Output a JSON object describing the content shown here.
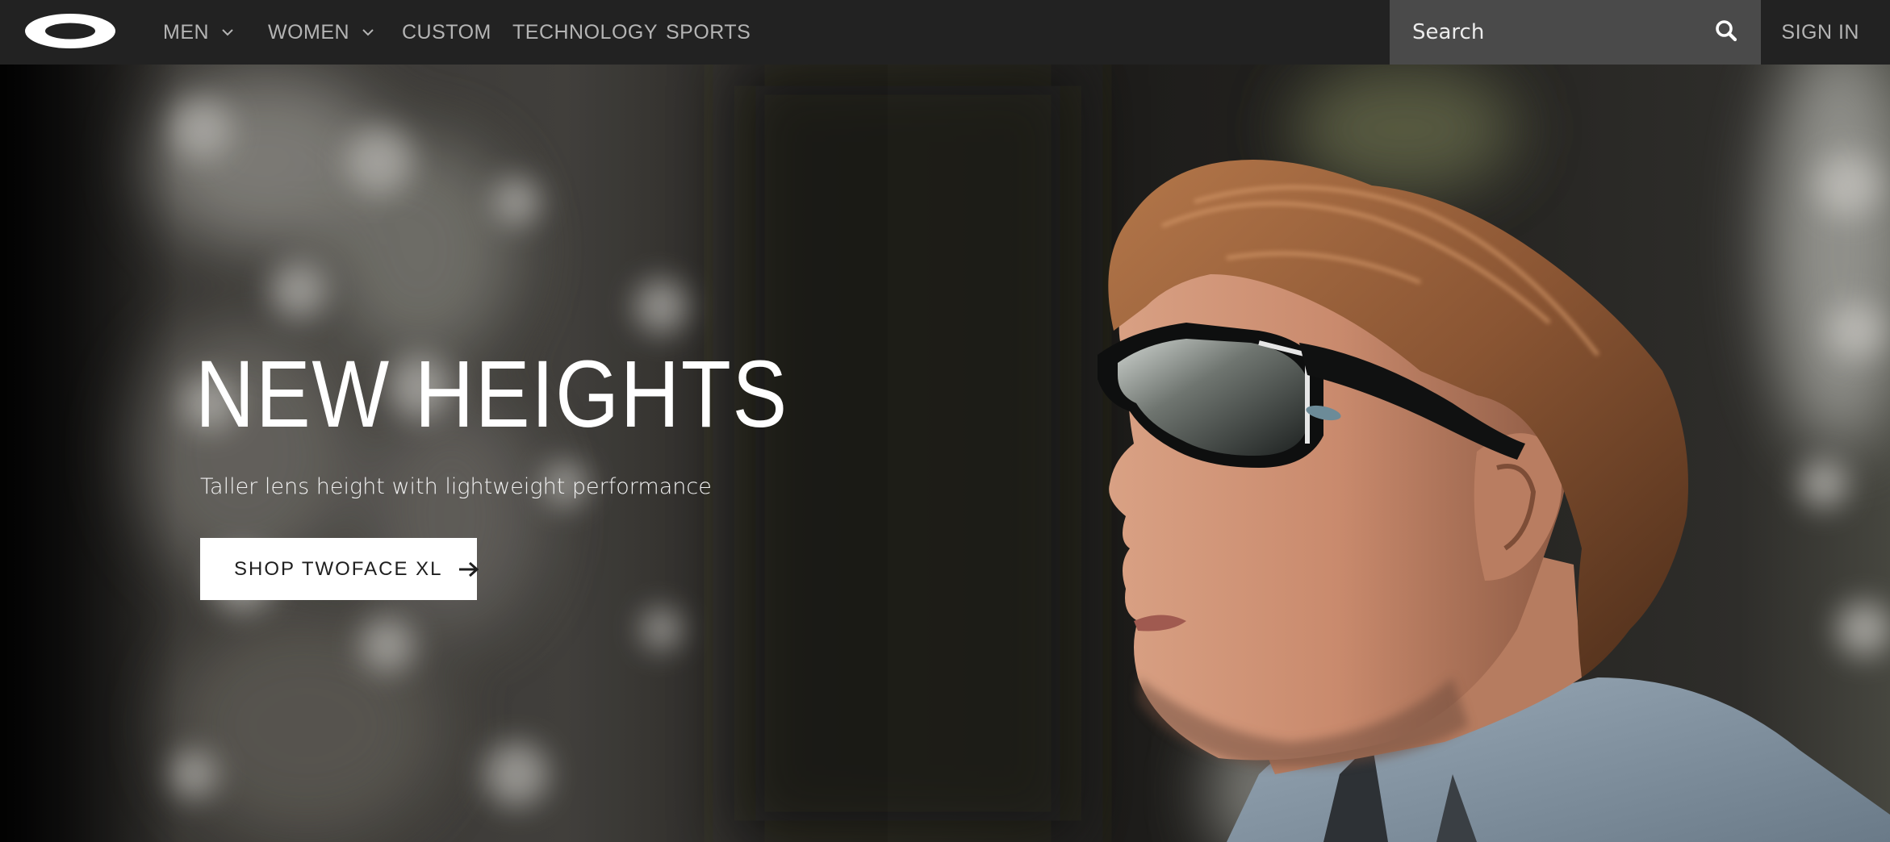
{
  "nav": {
    "logo_icon": "oakley-ellipse-logo-icon",
    "items": [
      {
        "label": "MEN",
        "has_dropdown": true
      },
      {
        "label": "WOMEN",
        "has_dropdown": true
      },
      {
        "label": "CUSTOM",
        "has_dropdown": false
      },
      {
        "label": "TECHNOLOGY",
        "has_dropdown": false
      },
      {
        "label": "SPORTS",
        "has_dropdown": false
      }
    ],
    "search": {
      "placeholder": "Search",
      "value": "",
      "icon": "search-icon"
    },
    "sign_in_label": "SIGN IN"
  },
  "hero": {
    "title": "NEW HEIGHTS",
    "subtitle": "Taller lens height with lightweight performance",
    "cta_label": "SHOP TWOFACE XL",
    "cta_icon": "arrow-right-icon",
    "image_subject": "man-wearing-sunglasses-in-forest"
  },
  "colors": {
    "nav_bg": "#222222",
    "nav_text": "#b4b4b4",
    "search_bg": "#4a4a4a",
    "cta_bg": "#ffffff",
    "cta_text": "#1e1e1e"
  }
}
